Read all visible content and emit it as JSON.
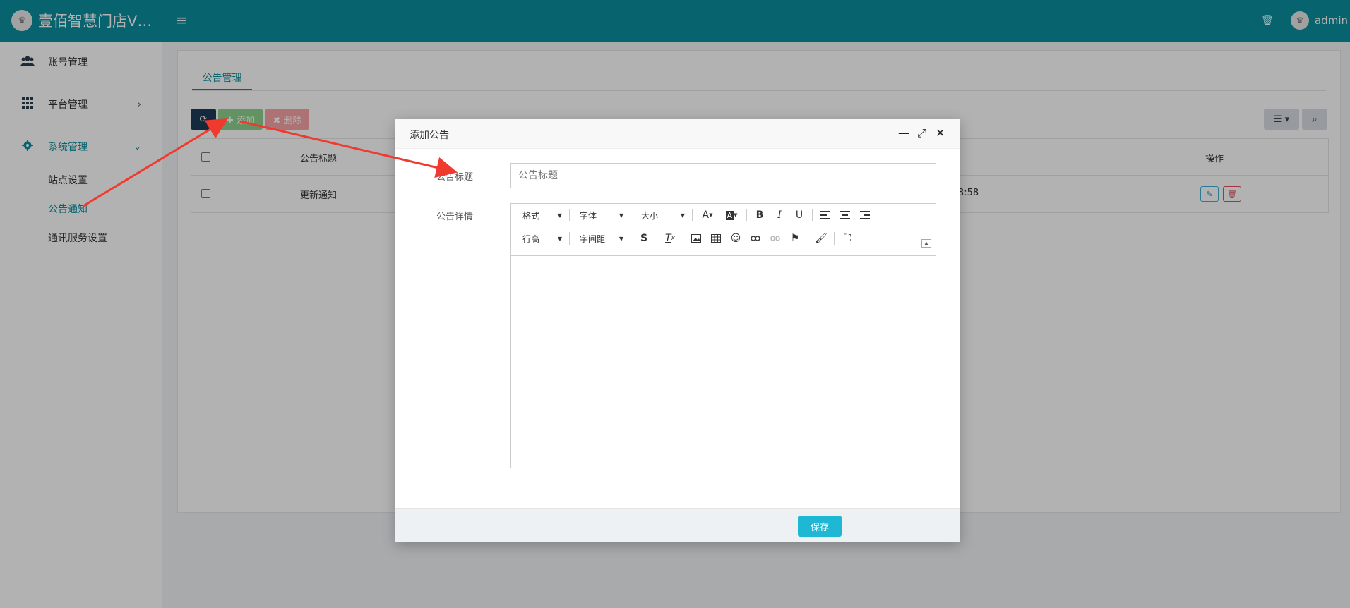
{
  "header": {
    "app_name": "壹佰智慧门店V…",
    "logo_text": "♛",
    "menu_icon": "≡",
    "trash_icon": "🗑",
    "user_name": "admin",
    "avatar_text": "♛"
  },
  "sidebar": {
    "items": [
      {
        "label": "账号管理",
        "icon": "users-icon"
      },
      {
        "label": "平台管理",
        "icon": "grid-icon",
        "chevron": "›"
      },
      {
        "label": "系统管理",
        "icon": "gear-icon",
        "chevron": "⌄"
      }
    ],
    "sub_items": [
      {
        "label": "站点设置"
      },
      {
        "label": "公告通知"
      },
      {
        "label": "通讯服务设置"
      }
    ]
  },
  "main": {
    "tab_label": "公告管理",
    "toolbar": {
      "refresh_icon": "⟳",
      "add_label": "✚ 添加",
      "delete_label": "✖ 删除",
      "view_icon": "☰ ▾",
      "search_icon": "⌕"
    },
    "table": {
      "headers": {
        "title": "公告标题",
        "actions": "操作"
      },
      "rows": [
        {
          "title": "更新通知",
          "time_fragment": "3:58"
        }
      ]
    }
  },
  "modal": {
    "title": "添加公告",
    "minimize_icon": "—",
    "maximize_icon": "⤢",
    "close_icon": "✕",
    "title_label": "公告标题",
    "title_placeholder": "公告标题",
    "title_value": "",
    "detail_label": "公告详情",
    "editor": {
      "row1_combos": [
        "格式",
        "字体",
        "大小"
      ],
      "row2_combos": [
        "行高",
        "字间距"
      ]
    },
    "save_label": "保存"
  },
  "colors": {
    "brand": "#0b8e9e",
    "annotation_arrow": "#f03a2e"
  }
}
